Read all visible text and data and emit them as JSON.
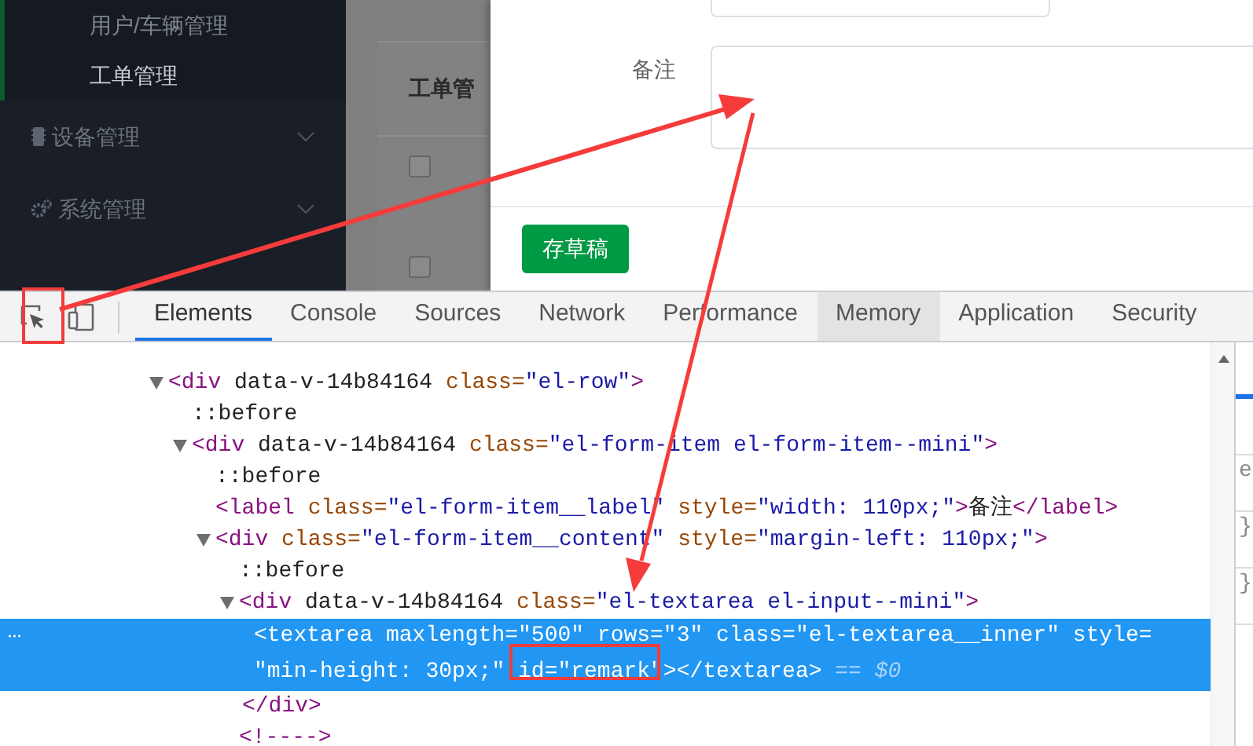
{
  "sidebar": {
    "submenu": [
      {
        "label": "用户/车辆管理",
        "selected": false
      },
      {
        "label": "工单管理",
        "selected": true
      }
    ],
    "menus": [
      {
        "label": "设备管理",
        "kind": "chip",
        "expanded": false
      },
      {
        "label": "系统管理",
        "kind": "gears",
        "expanded": false
      }
    ]
  },
  "page": {
    "card_title": "工单管",
    "rows": [
      {
        "checked": false
      },
      {
        "checked": false
      }
    ]
  },
  "dialog": {
    "fields": [
      {
        "label": "备注",
        "kind": "textarea"
      }
    ],
    "buttons": [
      {
        "label": "存草稿"
      }
    ]
  },
  "devtools": {
    "tabs": [
      {
        "label": "Elements",
        "selected": true,
        "hovered": false
      },
      {
        "label": "Console",
        "selected": false,
        "hovered": false
      },
      {
        "label": "Sources",
        "selected": false,
        "hovered": false
      },
      {
        "label": "Network",
        "selected": false,
        "hovered": false
      },
      {
        "label": "Performance",
        "selected": false,
        "hovered": false
      },
      {
        "label": "Memory",
        "selected": false,
        "hovered": true
      },
      {
        "label": "Application",
        "selected": false,
        "hovered": false
      },
      {
        "label": "Security",
        "selected": false,
        "hovered": false
      }
    ],
    "tree": [
      {
        "text": "<div data-v-14b84164 class=\"el-row\">",
        "expanded": true,
        "selected": false,
        "children": [
          {
            "text": "::before",
            "selected": false
          },
          {
            "text": "<div data-v-14b84164 class=\"el-form-item el-form-item--mini\">",
            "expanded": true,
            "selected": false,
            "children": [
              {
                "text": "::before",
                "selected": false
              },
              {
                "text": "<label class=\"el-form-item__label\" style=\"width: 110px;\">备注</label>",
                "selected": false
              },
              {
                "text": "<div class=\"el-form-item__content\" style=\"margin-left: 110px;\">",
                "expanded": true,
                "selected": false,
                "children": [
                  {
                    "text": "::before",
                    "selected": false
                  },
                  {
                    "text": "<div data-v-14b84164 class=\"el-textarea el-input--mini\">",
                    "expanded": true,
                    "selected": false,
                    "closing": "</div>",
                    "children": [
                      {
                        "text": "<textarea maxlength=\"500\" rows=\"3\" class=\"el-textarea__inner\" style= \"min-height: 30px;\" id=\"remark\"></textarea>",
                        "selected": true,
                        "suffix": "== $0"
                      }
                    ]
                  },
                  {
                    "text": "<!---->",
                    "selected": false
                  }
                ]
              }
            ]
          }
        ]
      }
    ],
    "side_pane": [
      "e",
      "}",
      "}"
    ]
  }
}
